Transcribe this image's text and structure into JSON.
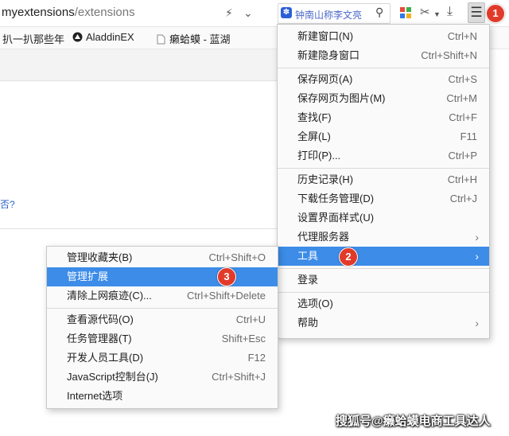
{
  "toolbar": {
    "url_host": "myextensions",
    "url_path": "/extensions",
    "search_placeholder": "钟南山称李文亮",
    "icons": [
      "lightning-icon",
      "chevron-down-icon",
      "paw-icon",
      "search-icon",
      "apps-icon",
      "scissors-icon",
      "download-icon",
      "menu-icon"
    ]
  },
  "bookmarks": [
    {
      "label": "扒一扒那些年"
    },
    {
      "label": "AladdinEX"
    },
    {
      "label": "癞蛤蟆 - 蓝湖"
    }
  ],
  "page": {
    "edge_text": "否?"
  },
  "main_menu": {
    "groups": [
      [
        {
          "label": "新建窗口(N)",
          "shortcut": "Ctrl+N"
        },
        {
          "label": "新建隐身窗口",
          "shortcut": "Ctrl+Shift+N"
        }
      ],
      [
        {
          "label": "保存网页(A)",
          "shortcut": "Ctrl+S"
        },
        {
          "label": "保存网页为图片(M)",
          "shortcut": "Ctrl+M"
        },
        {
          "label": "查找(F)",
          "shortcut": "Ctrl+F"
        },
        {
          "label": "全屏(L)",
          "shortcut": "F11"
        },
        {
          "label": "打印(P)...",
          "shortcut": "Ctrl+P"
        }
      ],
      [
        {
          "label": "历史记录(H)",
          "shortcut": "Ctrl+H"
        },
        {
          "label": "下载任务管理(D)",
          "shortcut": "Ctrl+J"
        },
        {
          "label": "设置界面样式(U)",
          "shortcut": ""
        },
        {
          "label": "代理服务器",
          "shortcut": "",
          "submenu": true
        },
        {
          "label": "工具",
          "shortcut": "",
          "submenu": true,
          "highlighted": true
        }
      ],
      [
        {
          "label": "登录",
          "shortcut": ""
        }
      ],
      [
        {
          "label": "选项(O)",
          "shortcut": ""
        },
        {
          "label": "帮助",
          "shortcut": "",
          "submenu": true
        }
      ]
    ]
  },
  "tools_menu": {
    "groups": [
      [
        {
          "label": "管理收藏夹(B)",
          "shortcut": "Ctrl+Shift+O"
        },
        {
          "label": "管理扩展",
          "shortcut": "",
          "highlighted": true
        },
        {
          "label": "清除上网痕迹(C)...",
          "shortcut": "Ctrl+Shift+Delete"
        }
      ],
      [
        {
          "label": "查看源代码(O)",
          "shortcut": "Ctrl+U"
        },
        {
          "label": "任务管理器(T)",
          "shortcut": "Shift+Esc"
        },
        {
          "label": "开发人员工具(D)",
          "shortcut": "F12"
        },
        {
          "label": "JavaScript控制台(J)",
          "shortcut": "Ctrl+Shift+J"
        },
        {
          "label": "Internet选项",
          "shortcut": ""
        }
      ]
    ]
  },
  "badges": [
    "1",
    "2",
    "3"
  ],
  "watermark": "搜狐号@癞蛤蟆电商工具达人",
  "colors": {
    "highlight": "#3c8ce8",
    "badge": "#e23a2a"
  }
}
